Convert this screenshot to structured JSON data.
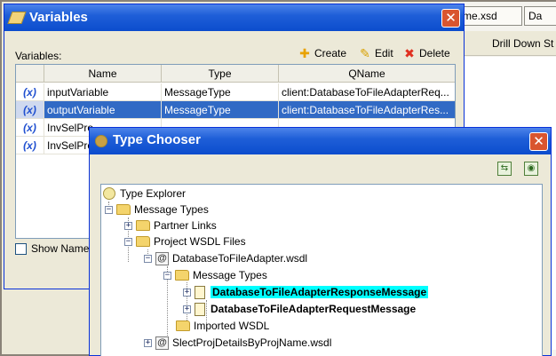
{
  "background": {
    "tabs": [
      "me.xsd",
      "Da"
    ],
    "toolbar_label": "Drill Down St"
  },
  "variables_dialog": {
    "title": "Variables",
    "section_label": "Variables:",
    "actions": {
      "create": "Create",
      "edit": "Edit",
      "delete": "Delete"
    },
    "columns": [
      "Name",
      "Type",
      "QName"
    ],
    "rows": [
      {
        "icon": "(x)",
        "name": "inputVariable",
        "type": "MessageType",
        "qname": "client:DatabaseToFileAdapterReq..."
      },
      {
        "icon": "(x)",
        "name": "outputVariable",
        "type": "MessageType",
        "qname": "client:DatabaseToFileAdapterRes..."
      },
      {
        "icon": "(x)",
        "name": "InvSelPro",
        "type": "",
        "qname": ""
      },
      {
        "icon": "(x)",
        "name": "InvSelPro",
        "type": "",
        "qname": ""
      }
    ],
    "selected_row": 1,
    "show_names_label": "Show Names",
    "show_names_checked": false
  },
  "type_chooser": {
    "title": "Type Chooser",
    "tree": {
      "root": "Type Explorer",
      "message_types": "Message Types",
      "partner_links": "Partner Links",
      "project_wsdl_files": "Project WSDL Files",
      "wsdl_1": "DatabaseToFileAdapter.wsdl",
      "wsdl_1_message_types": "Message Types",
      "response_message": "DatabaseToFileAdapterResponseMessage",
      "request_message": "DatabaseToFileAdapterRequestMessage",
      "imported_wsdl": "Imported WSDL",
      "wsdl_2": "SlectProjDetailsByProjName.wsdl"
    }
  }
}
